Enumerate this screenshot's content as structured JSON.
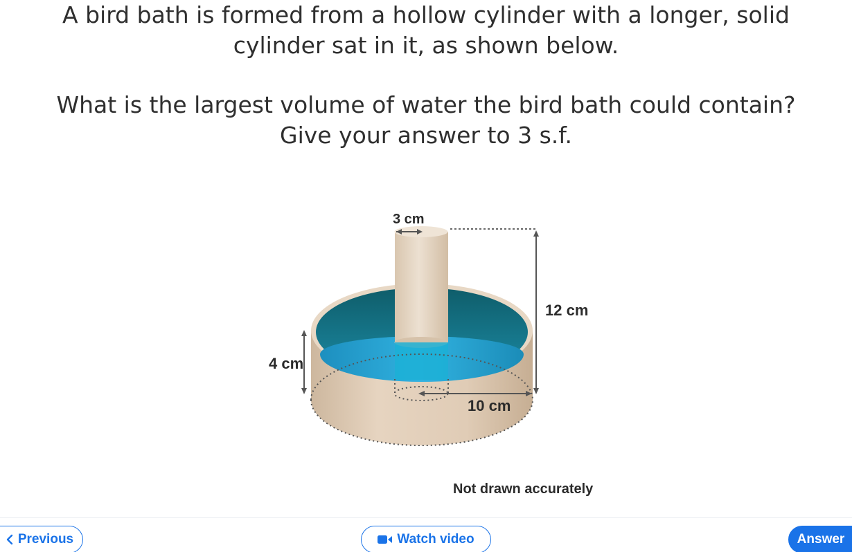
{
  "question": {
    "line1": "A bird bath is formed from a hollow cylinder with a longer, solid",
    "line2": "cylinder sat in it, as shown below.",
    "line3": "What is the largest volume of water the bird bath could contain?",
    "line4": "Give your answer to 3 s.f."
  },
  "diagram": {
    "label_3cm": "3 cm",
    "label_12cm": "12 cm",
    "label_4cm": "4 cm",
    "label_10cm": "10 cm",
    "note": "Not drawn accurately"
  },
  "nav": {
    "previous": "Previous",
    "watch_video": "Watch video",
    "answer": "Answer"
  },
  "icons": {
    "previous": "chevron-left-icon",
    "video": "video-camera-icon"
  },
  "colors": {
    "accent": "#1a73e8",
    "water": "#1a9bc9"
  }
}
